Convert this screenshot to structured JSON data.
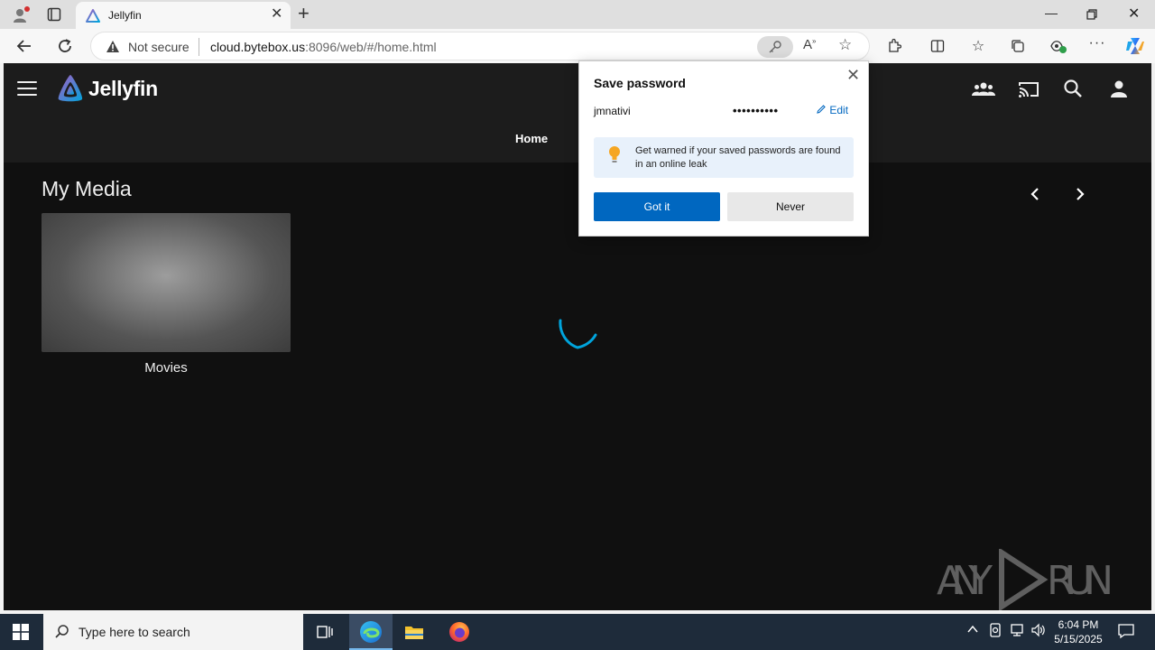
{
  "browser": {
    "tab_title": "Jellyfin",
    "tab_close": "✕",
    "new_tab": "+",
    "security_label": "Not secure",
    "url_host": "cloud.bytebox.us",
    "url_rest": ":8096/web/#/home.html"
  },
  "jellyfin": {
    "logo_text": "Jellyfin",
    "nav_home": "Home",
    "section_title": "My Media",
    "libraries": [
      {
        "label": "Movies"
      }
    ]
  },
  "save_password_popup": {
    "title": "Save password",
    "username": "jmnativi",
    "password_mask": "••••••••••",
    "edit_label": "Edit",
    "info_text": "Get warned if your saved passwords are found in an online leak",
    "primary_button": "Got it",
    "secondary_button": "Never"
  },
  "watermark": "ANY RUN",
  "taskbar": {
    "search_placeholder": "Type here to search",
    "time": "6:04 PM",
    "date": "5/15/2025"
  }
}
